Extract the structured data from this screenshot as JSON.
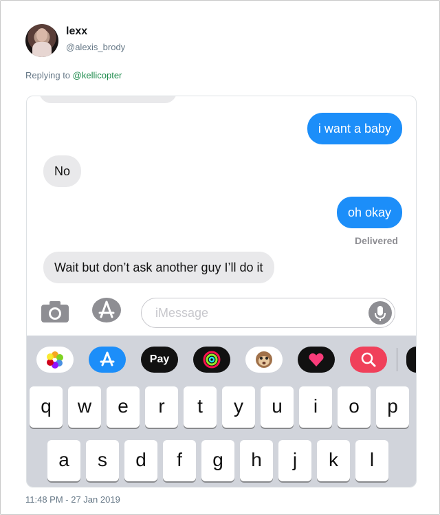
{
  "tweet": {
    "display_name": "lexx",
    "handle": "@alexis_brody",
    "replying_prefix": "Replying to ",
    "replying_to": "@kellicopter",
    "timestamp": "11:48 PM - 27 Jan 2019"
  },
  "conversation": {
    "messages": [
      {
        "direction": "out",
        "text": "i want a baby"
      },
      {
        "direction": "in",
        "text": "No"
      },
      {
        "direction": "out",
        "text": "oh okay"
      },
      {
        "direction": "in",
        "text": "Wait but don’t ask another guy I’ll do it"
      }
    ],
    "status": "Delivered"
  },
  "composer": {
    "placeholder": "iMessage"
  },
  "app_tray": [
    {
      "name": "photos-app-icon",
      "label": ""
    },
    {
      "name": "app-store-icon",
      "label": ""
    },
    {
      "name": "apple-pay-icon",
      "label": " Pay"
    },
    {
      "name": "activity-icon",
      "label": ""
    },
    {
      "name": "animoji-icon",
      "label": ""
    },
    {
      "name": "digital-touch-icon",
      "label": ""
    },
    {
      "name": "web-search-icon",
      "label": ""
    }
  ],
  "keyboard": {
    "row1": [
      "q",
      "w",
      "e",
      "r",
      "t",
      "y",
      "u",
      "i",
      "o",
      "p"
    ],
    "row2": [
      "a",
      "s",
      "d",
      "f",
      "g",
      "h",
      "j",
      "k",
      "l"
    ]
  },
  "colors": {
    "outgoing_bubble": "#1c8ef9",
    "incoming_bubble": "#e9e9eb",
    "keyboard_bg": "#d1d4db",
    "link": "#1b8a4a"
  }
}
